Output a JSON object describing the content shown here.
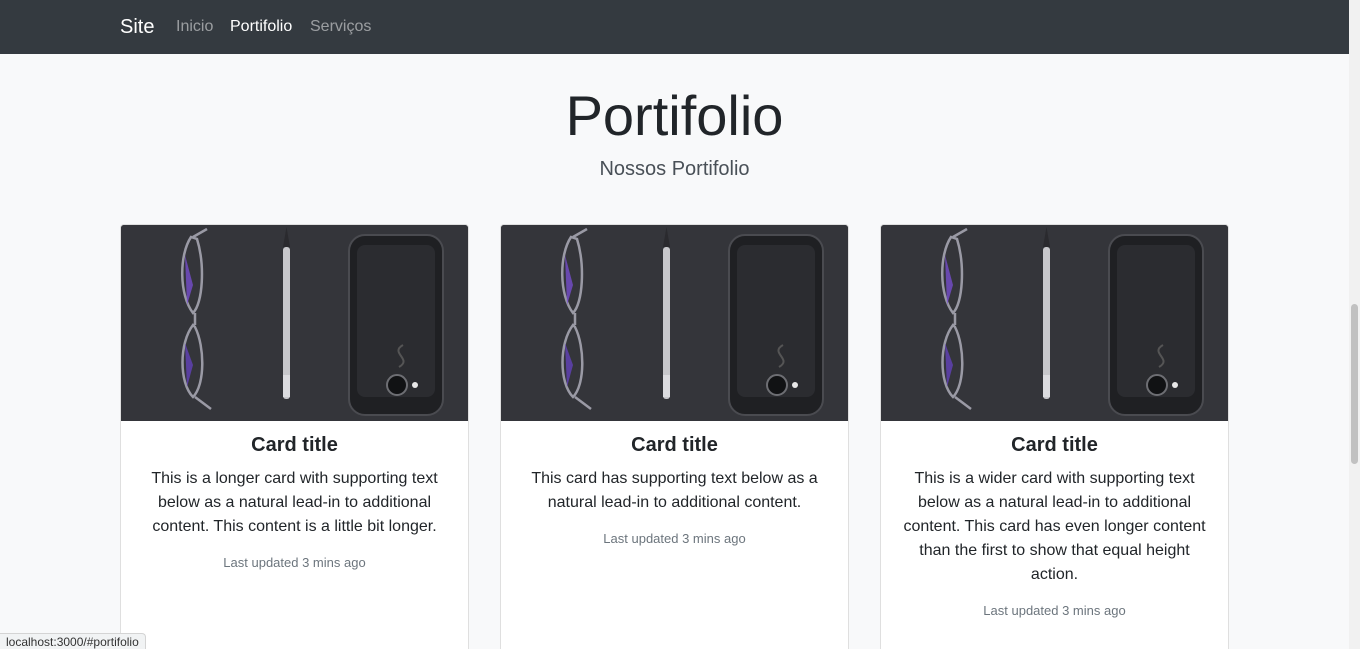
{
  "navbar": {
    "brand": "Site",
    "links": [
      {
        "label": "Inicio",
        "active": false
      },
      {
        "label": "Portifolio",
        "active": true
      },
      {
        "label": "Serviços",
        "active": false
      }
    ]
  },
  "header": {
    "title": "Portifolio",
    "subtitle": "Nossos Portifolio"
  },
  "cards": [
    {
      "title": "Card title",
      "text": "This is a longer card with supporting text below as a natural lead-in to additional content. This content is a little bit longer.",
      "meta": "Last updated 3 mins ago"
    },
    {
      "title": "Card title",
      "text": "This card has supporting text below as a natural lead-in to additional content.",
      "meta": "Last updated 3 mins ago"
    },
    {
      "title": "Card title",
      "text": "This is a wider card with supporting text below as a natural lead-in to additional content. This card has even longer content than the first to show that equal height action.",
      "meta": "Last updated 3 mins ago"
    }
  ],
  "status_bar": {
    "url": "localhost:3000/#portifolio"
  },
  "colors": {
    "navbar_bg": "#343a40",
    "page_bg": "#f8f9fa",
    "muted_text": "#6c757d"
  }
}
